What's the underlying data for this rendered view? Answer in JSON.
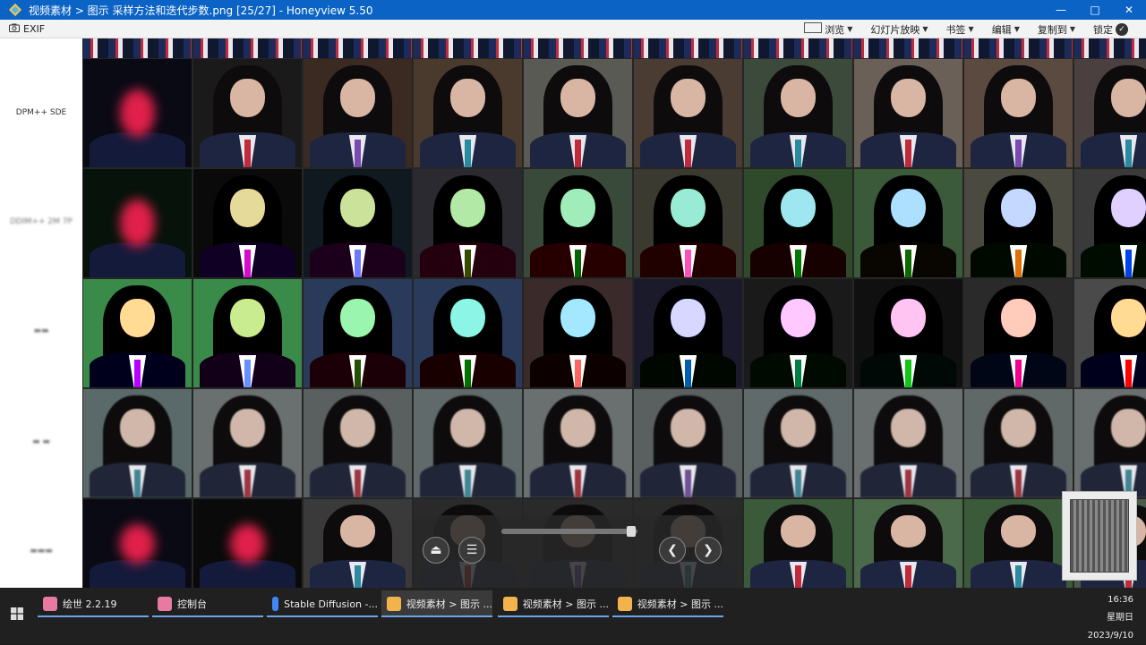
{
  "window": {
    "title": "视频素材 > 图示 采样方法和迭代步数.png [25/27] - Honeyview 5.50",
    "controls": [
      "—",
      "□",
      "✕"
    ]
  },
  "toolbar": {
    "exif_label": "EXIF",
    "items": [
      {
        "label": "浏览",
        "icon": "view-mode-icon"
      },
      {
        "label": "幻灯片放映"
      },
      {
        "label": "书签"
      },
      {
        "label": "编辑"
      },
      {
        "label": "复制到"
      },
      {
        "label": "锁定",
        "icon": "check-icon"
      }
    ]
  },
  "image": {
    "row_labels": [
      {
        "text": "DPM++ SDE",
        "legible": true
      },
      {
        "text": "DDIM++ 2M 7P",
        "legible": false
      },
      {
        "text": "",
        "legible": false
      },
      {
        "text": "",
        "legible": false
      },
      {
        "text": "",
        "legible": false
      }
    ]
  },
  "nav_pad": {
    "buttons": [
      "eject-icon",
      "menu-icon",
      "zoom-in-icon",
      "zoom-out-icon",
      "rotate-left-icon",
      "rotate-right-icon",
      "fit-icon",
      "prev-icon",
      "next-icon"
    ]
  },
  "taskbar": {
    "tasks": [
      {
        "label": "绘世 2.2.19",
        "icon_color": "#e67aa0",
        "active": false
      },
      {
        "label": "控制台",
        "icon_color": "#e67aa0",
        "active": false
      },
      {
        "label": "Stable Diffusion -...",
        "icon_color": "#4285f4",
        "active": false
      },
      {
        "label": "视频素材 > 图示 ...",
        "icon_color": "#f3b34c",
        "active": true
      },
      {
        "label": "视频素材 > 图示 ...",
        "icon_color": "#f3b34c",
        "active": false
      },
      {
        "label": "视频素材 > 图示 ...",
        "icon_color": "#f3b34c",
        "active": false
      }
    ],
    "clock": {
      "time": "16:36",
      "weekday": "星期日",
      "date": "2023/9/10"
    }
  }
}
